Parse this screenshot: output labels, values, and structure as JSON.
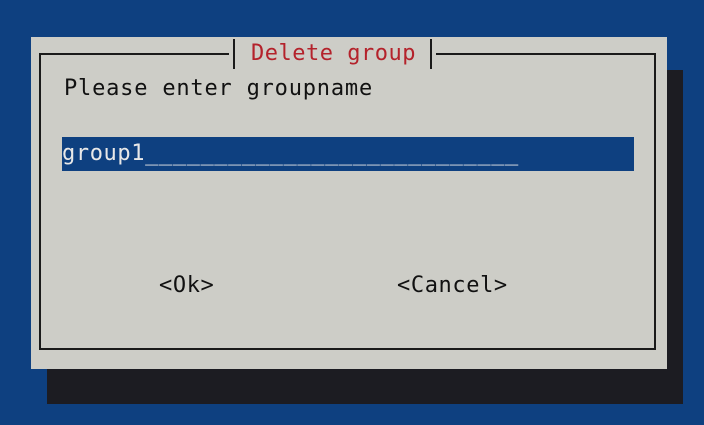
{
  "dialog": {
    "title": "Delete group",
    "prompt": "Please enter groupname",
    "input_value": "group1",
    "input_fill": "___________________________",
    "ok_label": "<Ok>",
    "cancel_label": "<Cancel>"
  },
  "colors": {
    "background": "#0e4080",
    "dialog": "#cdcdc7",
    "shadow": "#1c1c22",
    "title": "#b4222b",
    "input_background": "#0e4080"
  }
}
